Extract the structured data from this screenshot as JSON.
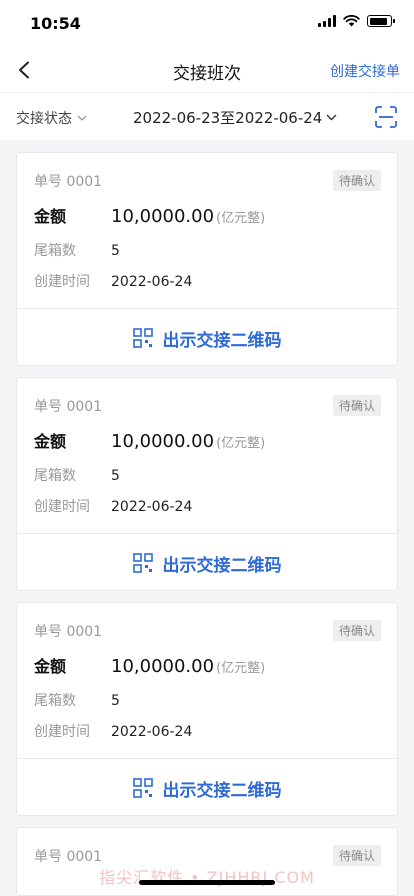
{
  "status_bar": {
    "time": "10:54"
  },
  "nav": {
    "title": "交接班次",
    "action_label": "创建交接单"
  },
  "filters": {
    "status_label": "交接状态",
    "date_range": "2022-06-23至2022-06-24"
  },
  "cards": [
    {
      "order": "单号 0001",
      "badge": "待确认",
      "amount_label": "金额",
      "amount_value": "10,0000.00",
      "amount_unit": "(亿元整)",
      "box_label": "尾箱数",
      "box_value": "5",
      "time_label": "创建时间",
      "time_value": "2022-06-24",
      "qr_label": "出示交接二维码"
    },
    {
      "order": "单号 0001",
      "badge": "待确认",
      "amount_label": "金额",
      "amount_value": "10,0000.00",
      "amount_unit": "(亿元整)",
      "box_label": "尾箱数",
      "box_value": "5",
      "time_label": "创建时间",
      "time_value": "2022-06-24",
      "qr_label": "出示交接二维码"
    },
    {
      "order": "单号 0001",
      "badge": "待确认",
      "amount_label": "金额",
      "amount_value": "10,0000.00",
      "amount_unit": "(亿元整)",
      "box_label": "尾箱数",
      "box_value": "5",
      "time_label": "创建时间",
      "time_value": "2022-06-24",
      "qr_label": "出示交接二维码"
    },
    {
      "order": "单号 0001",
      "badge": "待确认"
    }
  ],
  "watermark": "指尖汇软件 • ZJHHRJ.COM",
  "colors": {
    "accent": "#2f6bd8",
    "background": "#f4f5f7"
  }
}
